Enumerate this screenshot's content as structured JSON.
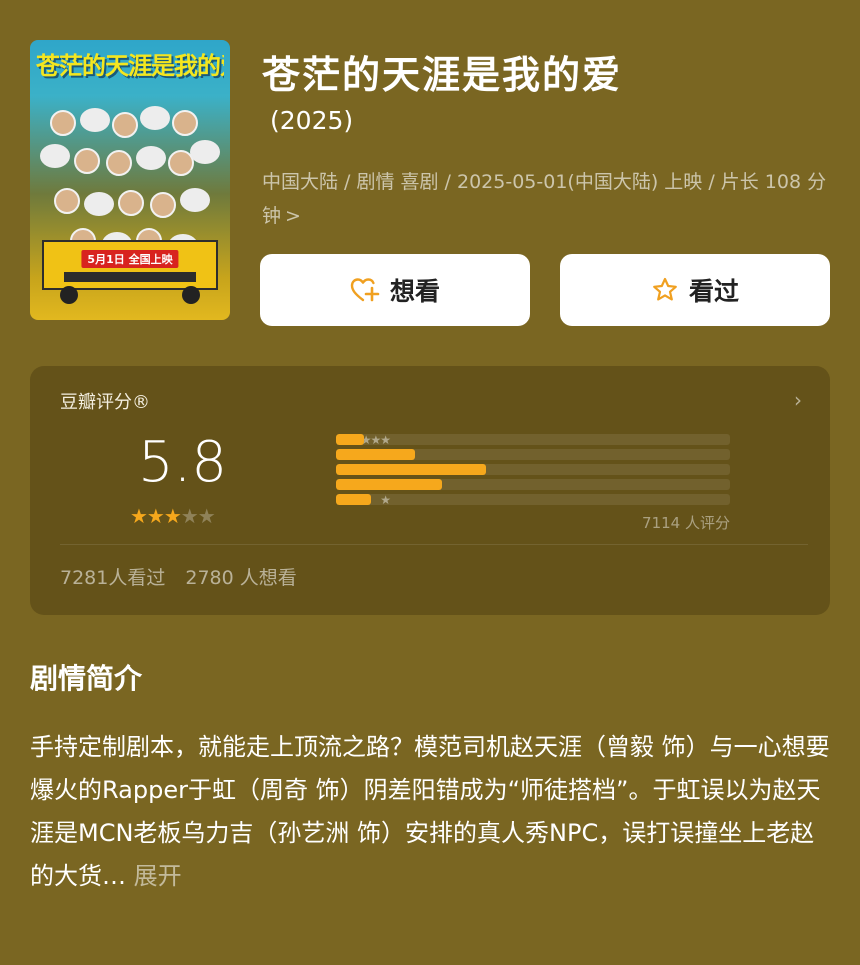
{
  "movie": {
    "title": "苍茫的天涯是我的爱",
    "year": "(2025)",
    "meta": "中国大陆 / 剧情 喜剧 / 2025-05-01(中国大陆) 上映 / 片长 108 分钟",
    "meta_chevron": ">"
  },
  "poster": {
    "title_text": "苍茫的天涯是我的爱",
    "banner_text": "5月1日 全国上映"
  },
  "actions": {
    "want_label": "想看",
    "seen_label": "看过"
  },
  "rating": {
    "label": "豆瓣评分®",
    "score": "5.8",
    "star_fill": 3,
    "star_total": 5,
    "stars_on": "★★★",
    "stars_off": "★★",
    "distribution": [
      {
        "stars": "★★★★★",
        "value": 0.07
      },
      {
        "stars": "★★★★",
        "value": 0.2
      },
      {
        "stars": "★★★",
        "value": 0.38
      },
      {
        "stars": "★★",
        "value": 0.27
      },
      {
        "stars": "★",
        "value": 0.09
      }
    ],
    "count_text": "7114 人评分",
    "seen_count_text": "7281人看过",
    "want_count_text": "2780 人想看"
  },
  "synopsis": {
    "heading": "剧情简介",
    "text": "手持定制剧本，就能走上顶流之路？模范司机赵天涯（曾毅 饰）与一心想要爆火的Rapper于虹（周奇 饰）阴差阳错成为“师徒搭档”。于虹误以为赵天涯是MCN老板乌力吉（孙艺洲 饰）安排的真人秀NPC，误打误撞坐上老赵的大货…",
    "more_label": "展开"
  },
  "colors": {
    "background": "#7a6622",
    "accent": "#f6a81c",
    "button_bg": "#ffffff"
  }
}
